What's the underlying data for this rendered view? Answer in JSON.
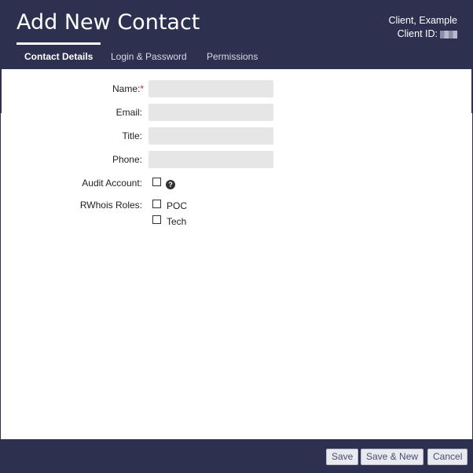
{
  "header": {
    "title": "Add New Contact",
    "client_name": "Client, Example",
    "client_id_label": "Client ID:",
    "colors": {
      "header_bg": "#2e3050",
      "text": "#ffffff"
    }
  },
  "tabs": [
    {
      "label": "Contact Details",
      "active": true
    },
    {
      "label": "Login & Password",
      "active": false
    },
    {
      "label": "Permissions",
      "active": false
    }
  ],
  "form": {
    "name_label": "Name:",
    "required_marker": "*",
    "email_label": "Email:",
    "title_label": "Title:",
    "phone_label": "Phone:",
    "audit_label": "Audit Account:",
    "rwhois_label": "RWhois Roles:",
    "roles": [
      "POC",
      "Tech"
    ],
    "values": {
      "name": "",
      "email": "",
      "title": "",
      "phone": ""
    }
  },
  "footer": {
    "save_label": "Save",
    "save_new_label": "Save & New",
    "cancel_label": "Cancel"
  }
}
